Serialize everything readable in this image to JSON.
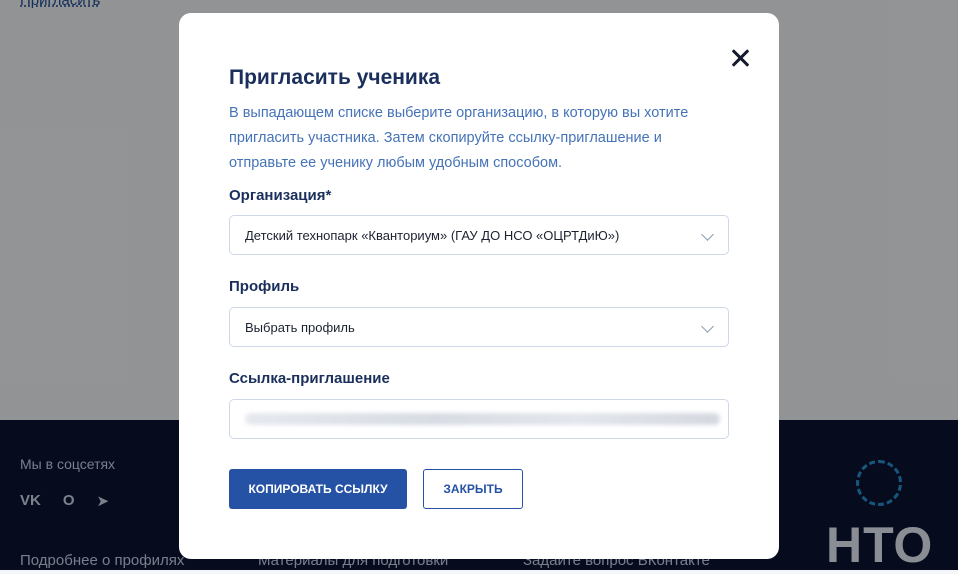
{
  "page": {
    "top_link": "Пригласить",
    "footer": {
      "social_title": "Мы в соцсетях",
      "social_icons": [
        "VK",
        "O",
        "➤"
      ],
      "links": [
        "Подробнее о профилях",
        "Материалы для подготовки",
        "Задайте вопрос ВКонтакте"
      ],
      "logo_text": "НТО"
    }
  },
  "modal": {
    "title": "Пригласить ученика",
    "description": "В выпадающем списке выберите организацию, в которую вы хотите пригласить участника. Затем скопируйте ссылку-приглашение и отправьте ее ученику любым удобным способом.",
    "organization_label": "Организация*",
    "organization_value": "Детский технопарк «Кванториум» (ГАУ ДО НСО «ОЦРТДиЮ»)",
    "profile_label": "Профиль",
    "profile_value": "Выбрать профиль",
    "link_label": "Ссылка-приглашение",
    "copy_button": "КОПИРОВАТЬ ССЫЛКУ",
    "close_button": "ЗАКРЫТЬ"
  }
}
